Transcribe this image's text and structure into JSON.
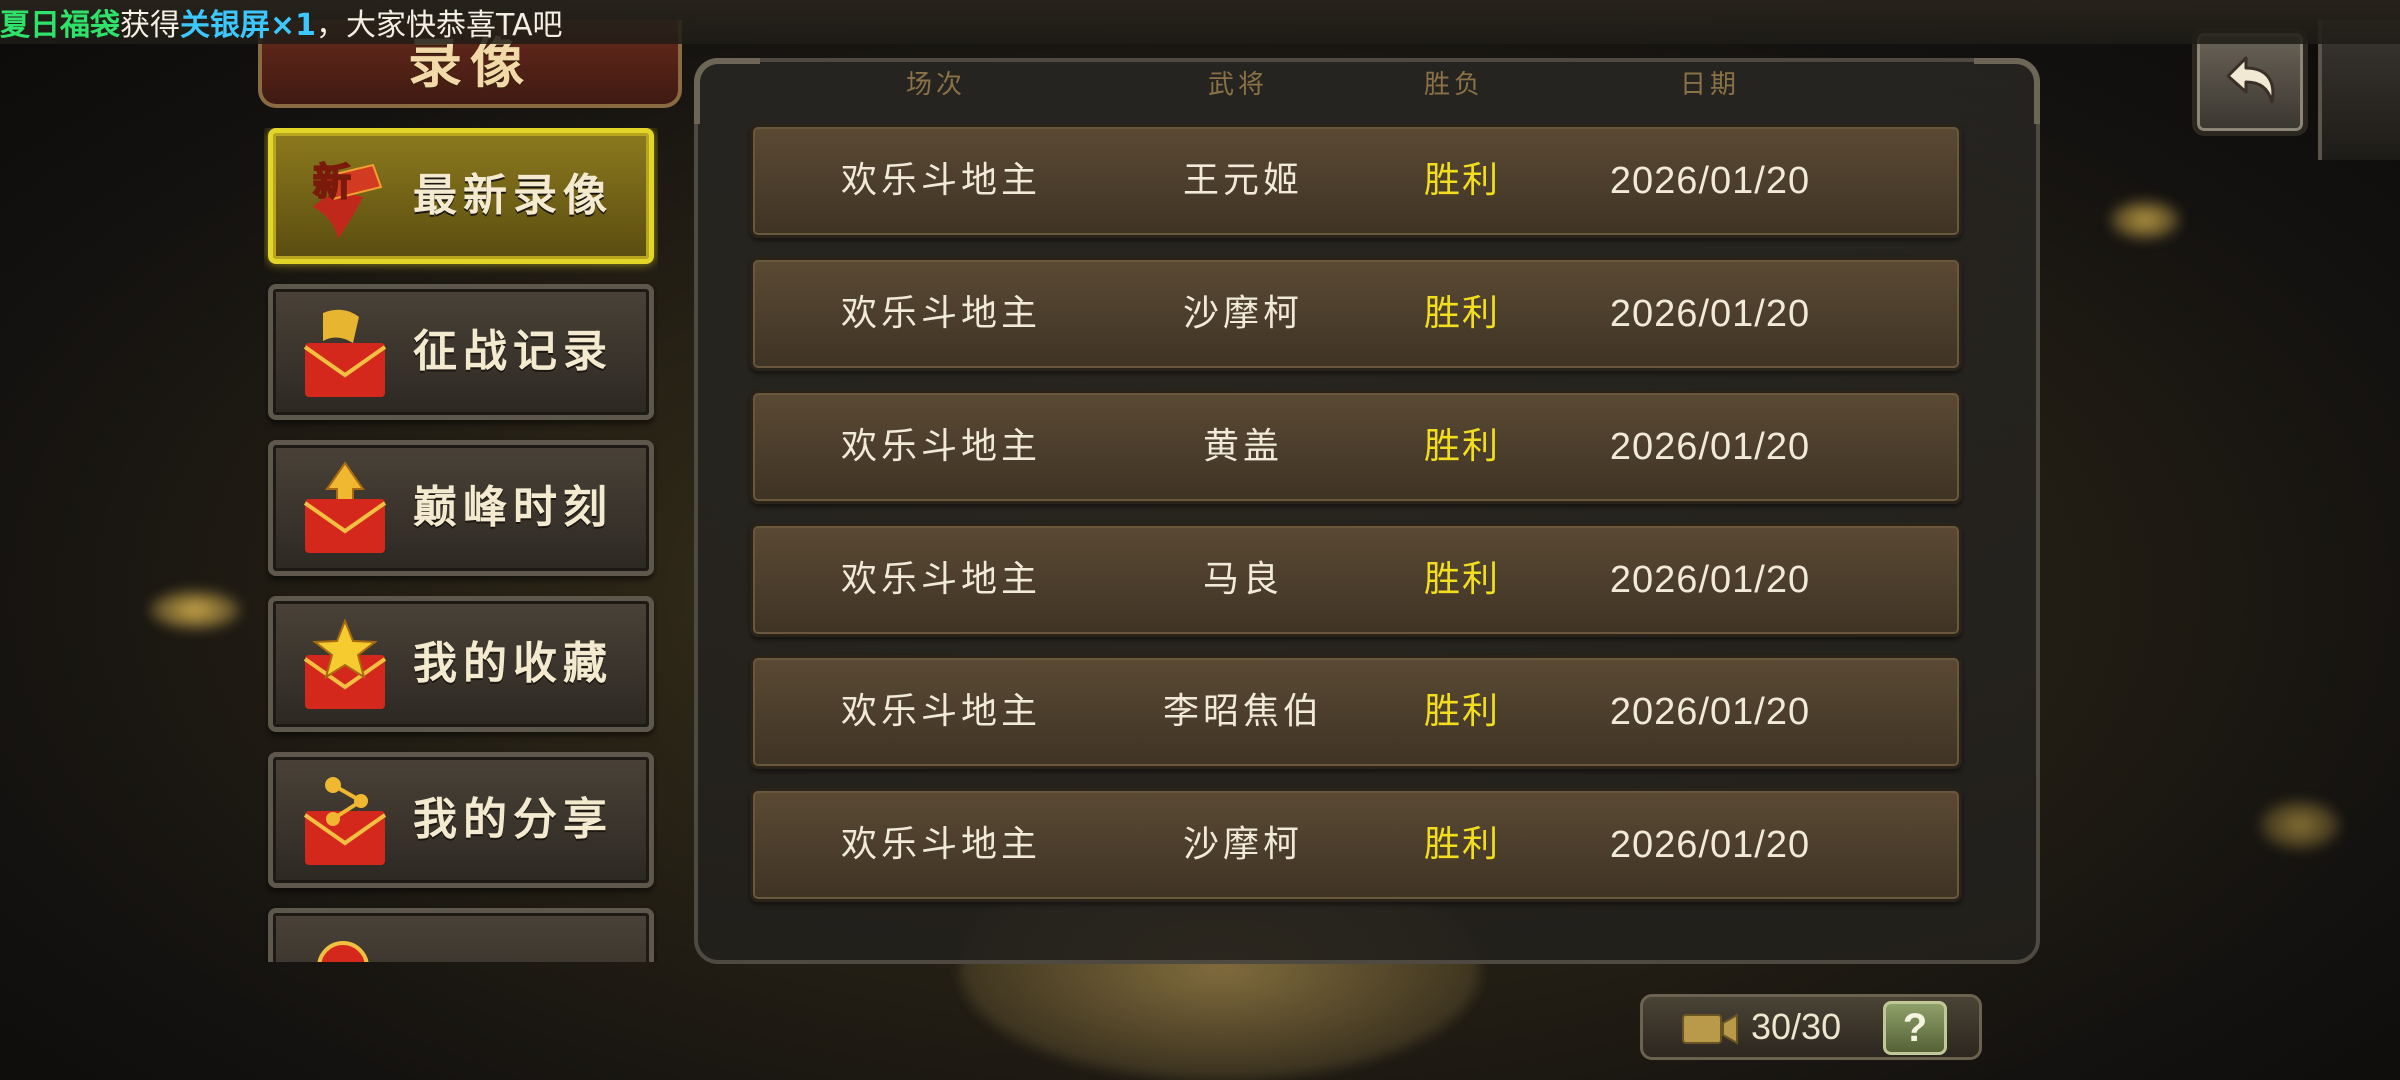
{
  "banner": {
    "part1": "夏日福袋",
    "part2": "获得",
    "part3": "关银屏×1",
    "part4": "，大家快恭喜TA吧"
  },
  "title": "录像",
  "colors": {
    "accent_yellow": "#e4d628",
    "win_text": "#f2de1e",
    "header_text": "#8a7246"
  },
  "menu": [
    {
      "label": "最新录像",
      "icon": "new-badge-icon",
      "active": true
    },
    {
      "label": "征战记录",
      "icon": "red-envelope-flag-icon",
      "active": false
    },
    {
      "label": "巅峰时刻",
      "icon": "red-envelope-arrow-icon",
      "active": false
    },
    {
      "label": "我的收藏",
      "icon": "red-envelope-star-icon",
      "active": false
    },
    {
      "label": "我的分享",
      "icon": "red-envelope-share-icon",
      "active": false
    },
    {
      "label": "",
      "icon": "red-envelope-icon",
      "active": false
    }
  ],
  "table": {
    "headers": {
      "mode": "场次",
      "general": "武将",
      "result": "胜负",
      "date": "日期"
    },
    "rows": [
      {
        "mode": "欢乐斗地主",
        "general": "王元姬",
        "result": "胜利",
        "date": "2026/01/20"
      },
      {
        "mode": "欢乐斗地主",
        "general": "沙摩柯",
        "result": "胜利",
        "date": "2026/01/20"
      },
      {
        "mode": "欢乐斗地主",
        "general": "黄盖",
        "result": "胜利",
        "date": "2026/01/20"
      },
      {
        "mode": "欢乐斗地主",
        "general": "马良",
        "result": "胜利",
        "date": "2026/01/20"
      },
      {
        "mode": "欢乐斗地主",
        "general": "李昭焦伯",
        "result": "胜利",
        "date": "2026/01/20"
      },
      {
        "mode": "欢乐斗地主",
        "general": "沙摩柯",
        "result": "胜利",
        "date": "2026/01/20"
      }
    ]
  },
  "footer": {
    "count": "30/30",
    "help": "?"
  }
}
